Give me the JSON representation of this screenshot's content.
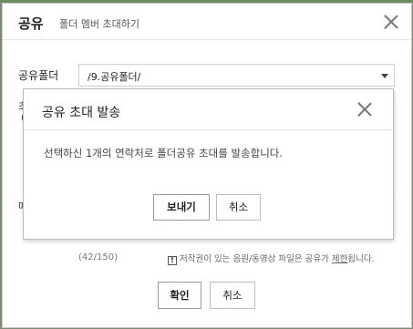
{
  "dialog": {
    "title": "공유",
    "subtitle": "폴더 멤버 초대하기",
    "folder_label": "공유폴더",
    "folder_value": "/9.공유폴더/",
    "partial_label_1": "초",
    "partial_label_2": "(",
    "partial_label_3": "메",
    "char_count": "(42/150)",
    "notice_prefix": "저작권이 있는 음원/동영상 파일은 공유가 ",
    "notice_underlined": "제한",
    "notice_suffix": "됩니다.",
    "confirm_label": "확인",
    "cancel_label": "취소"
  },
  "popup": {
    "title": "공유 초대 발송",
    "message": "선택하신 1개의 연락처로 폴더공유 초대를 발송합니다.",
    "send_label": "보내기",
    "cancel_label": "취소"
  },
  "icons": {
    "close": "close-icon",
    "warning": "exclamation-icon",
    "dropdown": "chevron-down-icon"
  },
  "colors": {
    "background": "#7d8a78",
    "border": "#bdbdbd"
  }
}
